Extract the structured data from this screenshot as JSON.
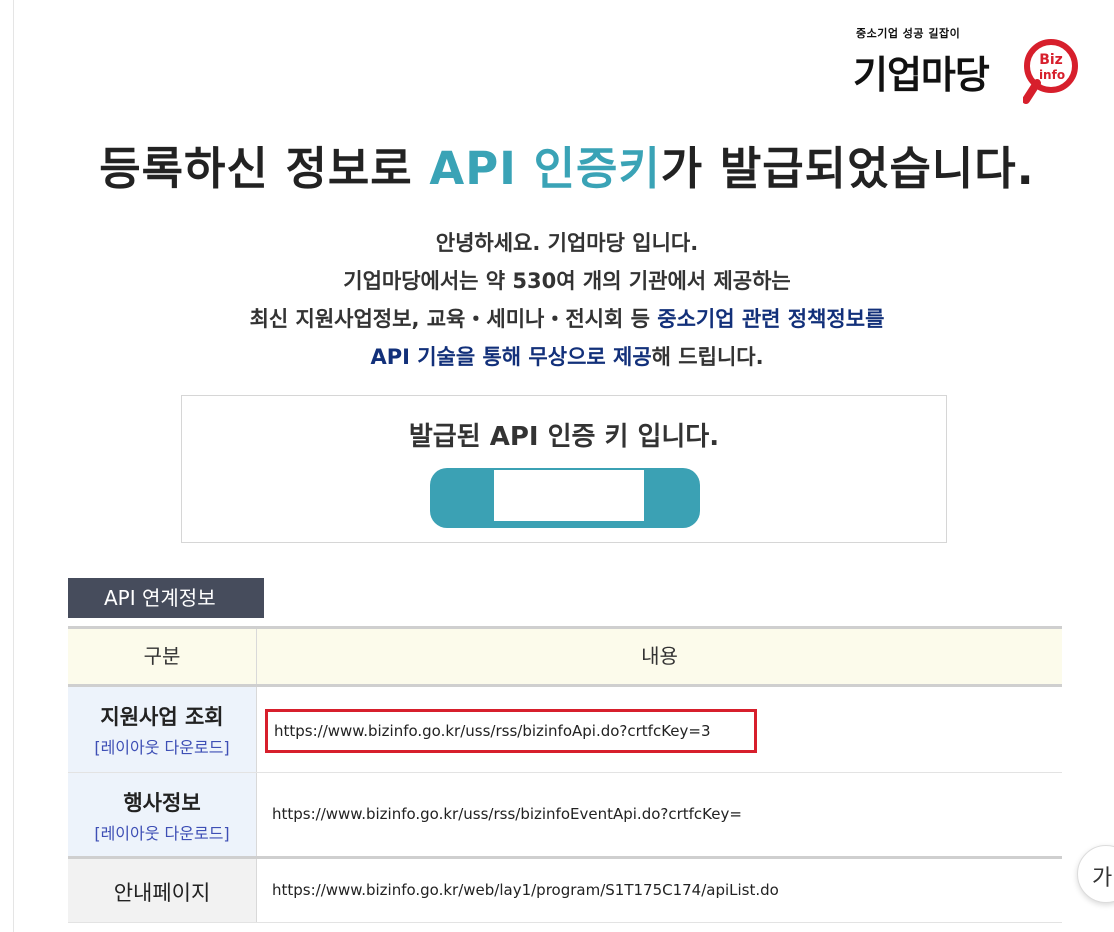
{
  "logo": {
    "tagline": "중소기업 성공 길잡이",
    "main": "기업마당",
    "badge_line1": "Biz",
    "badge_line2": "info"
  },
  "title": {
    "prefix": "등록하신 정보로 ",
    "accent": "API 인증키",
    "suffix": "가 발급되었습니다."
  },
  "intro": {
    "line1": "안녕하세요. 기업마당 입니다.",
    "line2": "기업마당에서는 약 530여 개의 기관에서 제공하는",
    "line3_prefix": "최신 지원사업정보, 교육・세미나・전시회 등 ",
    "line3_highlight": "중소기업 관련 정책정보를",
    "line4_highlight": "API 기술을 통해 무상으로 제공",
    "line4_suffix": "해 드립니다."
  },
  "key_box": {
    "title": "발급된 API 인증 키 입니다.",
    "key_value": ""
  },
  "section": {
    "heading": "API 연계정보"
  },
  "table": {
    "headers": {
      "category": "구분",
      "content": "내용"
    },
    "rows": [
      {
        "category": "지원사업 조회",
        "download": "[레이아웃 다운로드]",
        "url": "https://www.bizinfo.go.kr/uss/rss/bizinfoApi.do?crtfcKey=3"
      },
      {
        "category": "행사정보",
        "download": "[레이아웃 다운로드]",
        "url": "https://www.bizinfo.go.kr/uss/rss/bizinfoEventApi.do?crtfcKey="
      },
      {
        "category": "안내페이지",
        "url": "https://www.bizinfo.go.kr/web/lay1/program/S1T175C174/apiList.do"
      }
    ]
  },
  "floating_button": {
    "label": "가"
  },
  "colors": {
    "accent_teal": "#3aa3b6",
    "highlight_navy": "#12307a",
    "section_heading_bg": "#464c5c",
    "table_header_bg": "#fcfbeb",
    "category_cell_bg": "#edf3fb",
    "input_border_red": "#d71f2c",
    "link_blue": "#3e4fb5",
    "logo_red": "#d71f2c"
  }
}
